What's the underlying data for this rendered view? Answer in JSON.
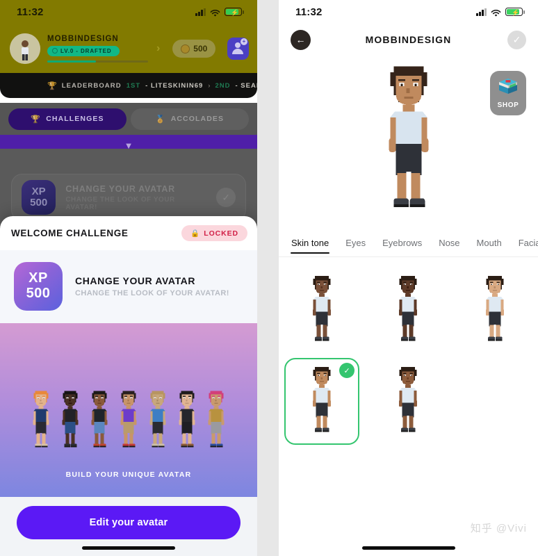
{
  "left_phone": {
    "status_bar": {
      "time": "11:32",
      "signal_icon": "signal-bars-icon",
      "wifi_icon": "wifi-icon",
      "battery_icon": "battery-charging-icon"
    },
    "profile": {
      "username": "MOBBINDESIGN",
      "level_badge": "LV.0 - DRAFTED",
      "coins": "500",
      "chevron": "›",
      "add_friend_icon": "add-friend-icon",
      "plus": "+"
    },
    "leaderboard": {
      "trophy_icon": "🏆",
      "label": "LEADERBOARD",
      "first_rank": "1ST",
      "first_user": "- LITESKININ69",
      "separator": "›",
      "second_rank": "2ND",
      "second_user": "- SEAN_MINN"
    },
    "segments": [
      {
        "label": "CHALLENGES",
        "icon": "🏆",
        "active": true
      },
      {
        "label": "ACCOLADES",
        "icon": "🏅",
        "active": false
      }
    ],
    "band_chevron": "▼",
    "background_card": {
      "xp_label": "XP",
      "xp_value": "500",
      "title": "CHANGE YOUR AVATAR",
      "subtitle": "CHANGE THE LOOK OF YOUR AVATAR!",
      "check_icon": "✓"
    },
    "sheet": {
      "title": "WELCOME CHALLENGE",
      "status_badge": {
        "lock_icon": "🔒",
        "label": "LOCKED"
      },
      "card": {
        "xp_label": "XP",
        "xp_value": "500",
        "title": "CHANGE YOUR AVATAR",
        "subtitle": "CHANGE THE LOOK OF YOUR AVATAR!"
      },
      "promo_caption": "BUILD YOUR UNIQUE AVATAR",
      "cta_label": "Edit your avatar"
    }
  },
  "right_phone": {
    "status_bar": {
      "time": "11:32",
      "signal_icon": "signal-bars-icon",
      "wifi_icon": "wifi-icon",
      "battery_icon": "battery-charging-icon"
    },
    "header": {
      "back_icon": "←",
      "title": "MOBBINDESIGN",
      "confirm_icon": "✓"
    },
    "shop": {
      "label": "SHOP",
      "icon": "shop-box-icon"
    },
    "tabs": [
      {
        "label": "Skin tone",
        "active": true
      },
      {
        "label": "Eyes",
        "active": false
      },
      {
        "label": "Eyebrows",
        "active": false
      },
      {
        "label": "Nose",
        "active": false
      },
      {
        "label": "Mouth",
        "active": false
      },
      {
        "label": "Facial",
        "active": false
      }
    ],
    "skin_tone_options": [
      {
        "index": 1,
        "skin": "#7a5039",
        "selected": false
      },
      {
        "index": 2,
        "skin": "#5d3a28",
        "selected": false
      },
      {
        "index": 3,
        "skin": "#d9a982",
        "selected": false
      },
      {
        "index": 4,
        "skin": "#c08a5e",
        "selected": true
      },
      {
        "index": 5,
        "skin": "#8d5c3c",
        "selected": false
      }
    ],
    "selected_badge_icon": "✓",
    "accent_green": "#34c56f"
  },
  "watermark": "知乎 @Vivi",
  "colors": {
    "brand_purple": "#5b19f5",
    "locked_pink_bg": "#fbd7dd",
    "locked_red_text": "#d11f46",
    "green_accent": "#34c56f",
    "olive_hero": "#827a00"
  }
}
